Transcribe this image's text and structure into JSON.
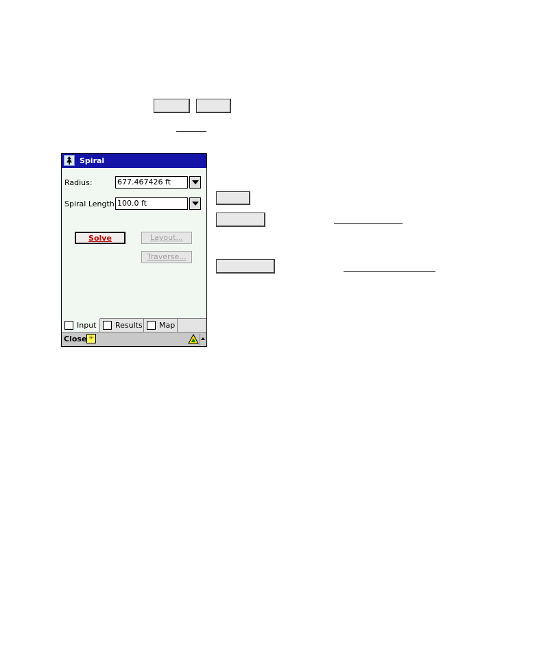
{
  "window": {
    "title": "Spiral",
    "icon": "surveyor-app-icon"
  },
  "form": {
    "radius_label": "Radius:",
    "radius_value": "677.467426 ft",
    "spiral_length_label": "Spiral Length:",
    "spiral_length_value": "100.0 ft"
  },
  "buttons": {
    "solve": "Solve",
    "layout": "Layout...",
    "traverse": "Traverse..."
  },
  "tabs": [
    {
      "label": "Input",
      "icon": "input-form-icon",
      "active": true
    },
    {
      "label": "Results",
      "icon": "results-document-icon",
      "active": false
    },
    {
      "label": "Map",
      "icon": "map-icon",
      "active": false
    }
  ],
  "command_bar": {
    "close": "Close",
    "sun_icon": "sun-icon",
    "warning_icon": "warning-triangle-icon"
  },
  "colors": {
    "titlebar": "#1414a8",
    "window_bg": "#f1f8f1",
    "solve_text": "#c00000"
  }
}
